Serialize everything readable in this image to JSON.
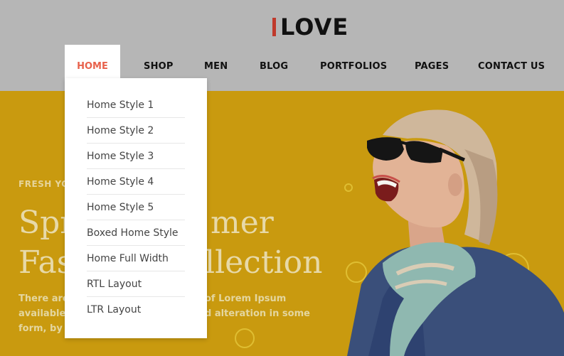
{
  "logo": {
    "text": "LOVE"
  },
  "nav": {
    "home": "HOME",
    "shop": "SHOP",
    "men": "MEN",
    "blog": "BLOG",
    "portfolios": "PORTFOLIOS",
    "pages": "PAGES",
    "contact": "CONTACT US"
  },
  "dropdown": {
    "items": [
      "Home Style 1",
      "Home Style 2",
      "Home Style 3",
      "Home Style 4",
      "Home Style 5",
      "Boxed Home Style",
      "Home Full Width",
      "RTL Layout",
      "LTR Layout"
    ]
  },
  "hero": {
    "kicker": "FRESH YO",
    "title_line1_left": "Spr",
    "title_line1_right": "mer",
    "title_line2_left": "Fas",
    "title_line2_right": "llection",
    "body_line1_left": "There are",
    "body_line1_right": "of Lorem Ipsum",
    "body_line2_left": "available,",
    "body_line2_right": "d alteration in some",
    "body_line3_left": "form, by i"
  },
  "colors": {
    "accent": "#e8624c",
    "logo_bar": "#c0392b",
    "hero_bg": "#c99a0f",
    "header_bg": "#b6b6b6"
  }
}
